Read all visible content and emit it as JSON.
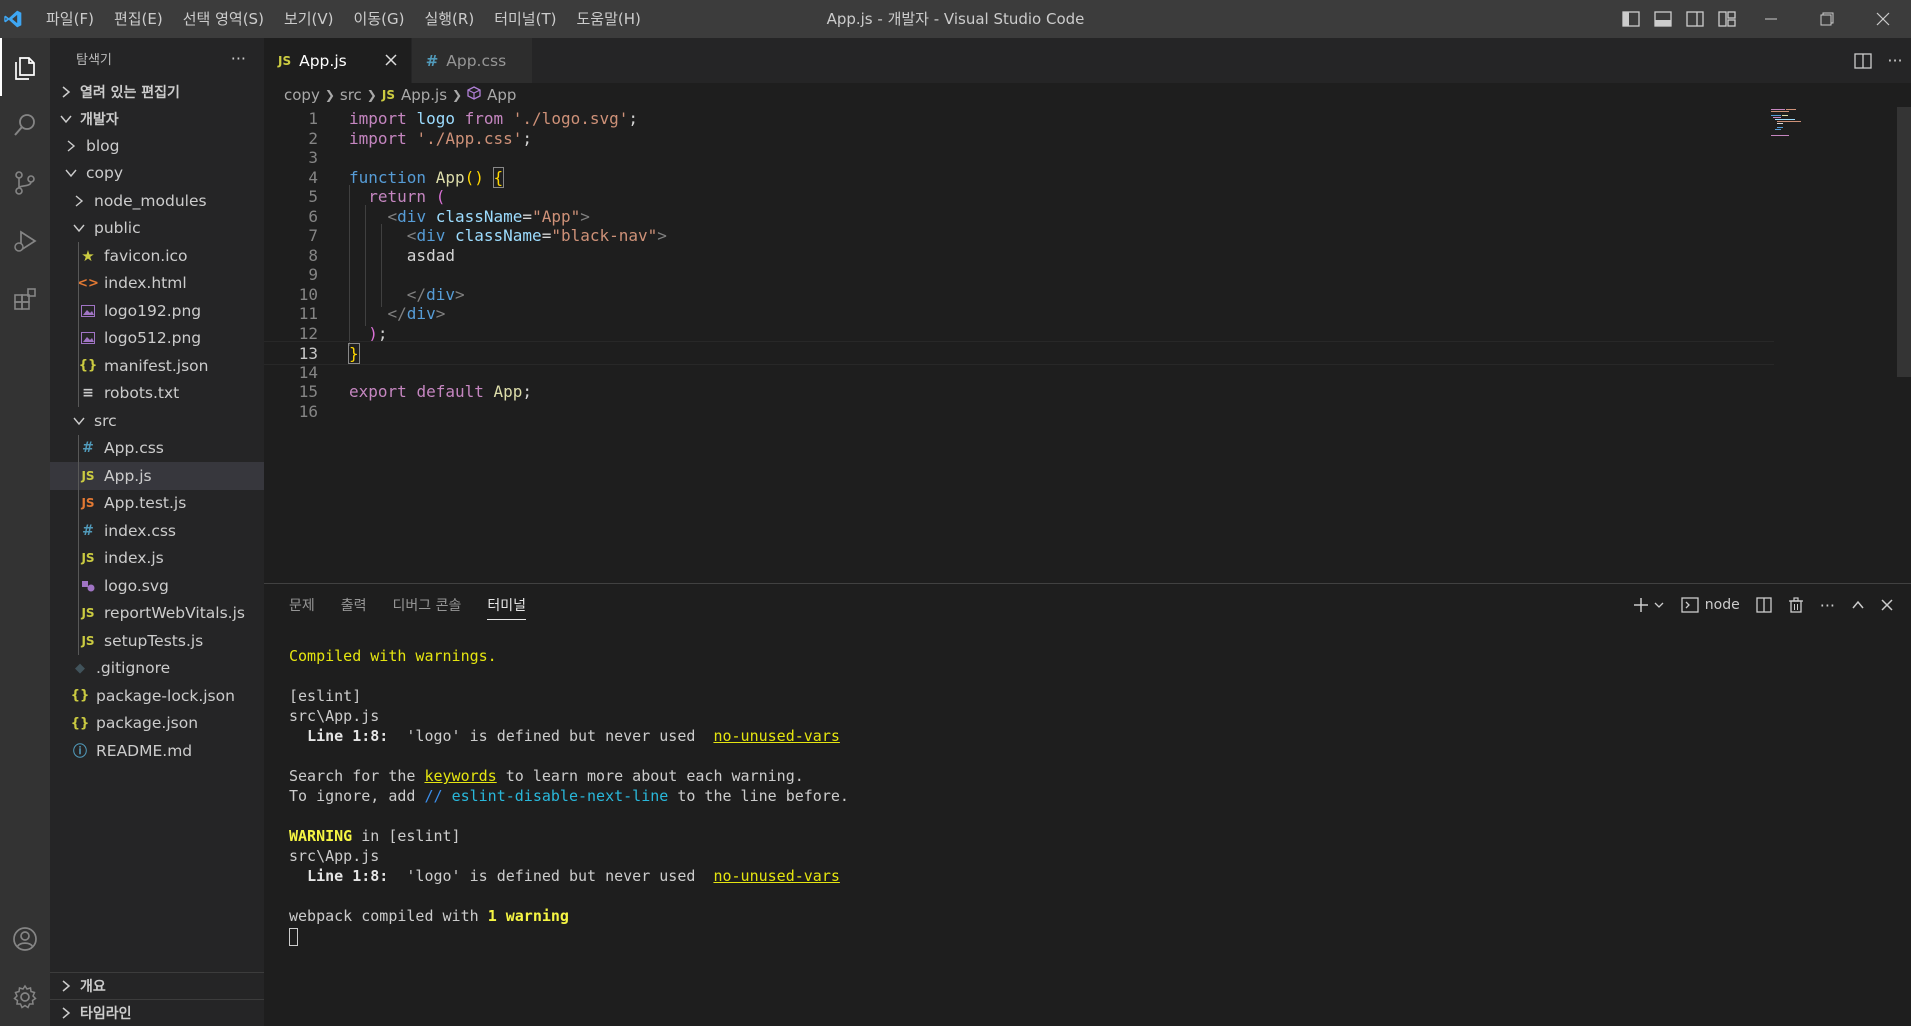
{
  "window": {
    "title": "App.js - 개발자 - Visual Studio Code",
    "menu": [
      "파일(F)",
      "편집(E)",
      "선택 영역(S)",
      "보기(V)",
      "이동(G)",
      "실행(R)",
      "터미널(T)",
      "도움말(H)"
    ]
  },
  "sidebar": {
    "title": "탐색기",
    "more_label": "···",
    "open_editors": "열려 있는 편집기",
    "workspace": "개발자",
    "tree": [
      {
        "label": "blog",
        "type": "folder",
        "expanded": false,
        "depth": 1
      },
      {
        "label": "copy",
        "type": "folder",
        "expanded": true,
        "depth": 1
      },
      {
        "label": "node_modules",
        "type": "folder",
        "expanded": false,
        "depth": 2
      },
      {
        "label": "public",
        "type": "folder",
        "expanded": true,
        "depth": 2
      },
      {
        "label": "favicon.ico",
        "type": "favicon",
        "depth": 3
      },
      {
        "label": "index.html",
        "type": "html",
        "depth": 3
      },
      {
        "label": "logo192.png",
        "type": "image",
        "depth": 3
      },
      {
        "label": "logo512.png",
        "type": "image",
        "depth": 3
      },
      {
        "label": "manifest.json",
        "type": "json",
        "depth": 3
      },
      {
        "label": "robots.txt",
        "type": "text",
        "depth": 3
      },
      {
        "label": "src",
        "type": "folder",
        "expanded": true,
        "depth": 2
      },
      {
        "label": "App.css",
        "type": "css",
        "depth": 3
      },
      {
        "label": "App.js",
        "type": "js",
        "depth": 3,
        "selected": true
      },
      {
        "label": "App.test.js",
        "type": "test",
        "depth": 3
      },
      {
        "label": "index.css",
        "type": "css",
        "depth": 3
      },
      {
        "label": "index.js",
        "type": "js",
        "depth": 3
      },
      {
        "label": "logo.svg",
        "type": "svg",
        "depth": 3
      },
      {
        "label": "reportWebVitals.js",
        "type": "js",
        "depth": 3
      },
      {
        "label": "setupTests.js",
        "type": "js",
        "depth": 3
      },
      {
        "label": ".gitignore",
        "type": "git",
        "depth": 2
      },
      {
        "label": "package-lock.json",
        "type": "json",
        "depth": 2
      },
      {
        "label": "package.json",
        "type": "json",
        "depth": 2
      },
      {
        "label": "README.md",
        "type": "info",
        "depth": 2
      }
    ],
    "outline": "개요",
    "timeline": "타임라인"
  },
  "tabs": [
    {
      "label": "App.js",
      "icon": "JS",
      "active": true
    },
    {
      "label": "App.css",
      "icon": "#",
      "active": false
    }
  ],
  "breadcrumb": {
    "folder1": "copy",
    "folder2": "src",
    "file": "App.js",
    "symbol": "App"
  },
  "editor": {
    "lines": [
      {
        "n": "1",
        "html": "<span class=\"kw\">import</span> <span class=\"var\">logo</span> <span class=\"kw\">from</span> <span class=\"str\">'./logo.svg'</span>;"
      },
      {
        "n": "2",
        "html": "<span class=\"kw\">import</span> <span class=\"str\">'./App.css'</span>;"
      },
      {
        "n": "3",
        "html": ""
      },
      {
        "n": "4",
        "html": "<span class=\"kw2\">function</span> <span class=\"fn\">App</span><span class=\"br1\">()</span> <span class=\"br1 boxed\">{</span>"
      },
      {
        "n": "5",
        "html": "  <span class=\"kw\">return</span> <span class=\"br2\">(</span>"
      },
      {
        "n": "6",
        "html": "    <span class=\"punct\">&lt;</span><span class=\"tag\">div</span> <span class=\"var\">className</span>=<span class=\"str\">\"App\"</span><span class=\"punct\">&gt;</span>"
      },
      {
        "n": "7",
        "html": "      <span class=\"punct\">&lt;</span><span class=\"tag\">div</span> <span class=\"var\">className</span>=<span class=\"str\">\"black-nav\"</span><span class=\"punct\">&gt;</span>"
      },
      {
        "n": "8",
        "html": "      asdad"
      },
      {
        "n": "9",
        "html": ""
      },
      {
        "n": "10",
        "html": "      <span class=\"punct\">&lt;/</span><span class=\"tag\">div</span><span class=\"punct\">&gt;</span>"
      },
      {
        "n": "11",
        "html": "    <span class=\"punct\">&lt;/</span><span class=\"tag\">div</span><span class=\"punct\">&gt;</span>"
      },
      {
        "n": "12",
        "html": "  <span class=\"br2\">)</span>;"
      },
      {
        "n": "13",
        "html": "<span class=\"br1 boxed\">}</span>"
      },
      {
        "n": "14",
        "html": ""
      },
      {
        "n": "15",
        "html": "<span class=\"kw\">export</span> <span class=\"kw\">default</span> <span class=\"fn\">App</span>;"
      },
      {
        "n": "16",
        "html": ""
      }
    ],
    "current_line": "13"
  },
  "panel": {
    "tabs": [
      "문제",
      "출력",
      "디버그 콘솔",
      "터미널"
    ],
    "active_tab": "터미널",
    "terminal_name": "node"
  },
  "terminal": {
    "compiled": "Compiled with warnings.",
    "eslint_tag": "[eslint]",
    "file": "src\\App.js",
    "line_ref": "Line 1:8:",
    "message": "'logo' is defined but never used",
    "rule": "no-unused-vars",
    "search_pre": "Search for the ",
    "keywords": "keywords",
    "search_post": " to learn more about each warning.",
    "ignore_pre": "To ignore, add ",
    "comment_slashes": "//",
    "disable_directive": "eslint-disable-next-line",
    "ignore_post": " to the line before.",
    "warning_label": "WARNING",
    "warning_in": " in [eslint]",
    "webpack_pre": "webpack compiled with ",
    "warning_count": "1 warning"
  },
  "colors": {
    "accent": "#007acc",
    "js_icon": "#cbcb41",
    "css_icon": "#519aba",
    "html_icon": "#e37933",
    "svg_icon": "#a074c4",
    "json_icon": "#cbcb41",
    "test_icon": "#e37933"
  }
}
